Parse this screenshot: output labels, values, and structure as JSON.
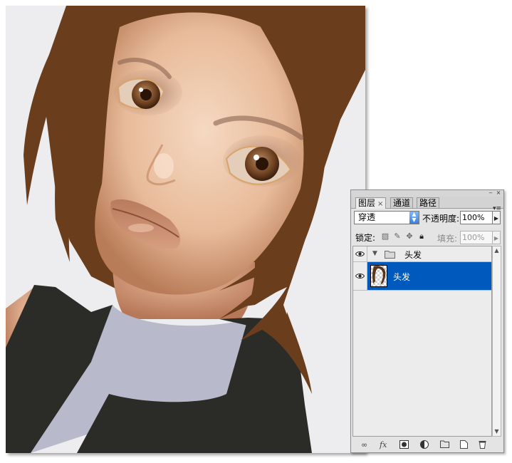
{
  "panel": {
    "tabs": [
      {
        "label": "图层",
        "close": "×"
      },
      {
        "label": "通道"
      },
      {
        "label": "路径"
      }
    ],
    "window_buttons": {
      "minimize": "‒",
      "close": "×"
    },
    "menu_icon": "▾≡",
    "blend_mode": "穿透",
    "opacity_label": "不透明度:",
    "opacity_value": "100%",
    "lock_label": "锁定:",
    "fill_label": "填充:",
    "fill_value": "100%",
    "layers": [
      {
        "name": "头发",
        "kind": "group",
        "expanded": true,
        "visible": true
      },
      {
        "name": "头发",
        "kind": "layer",
        "selected": true,
        "visible": true
      }
    ],
    "bottom_icons": [
      "link-icon",
      "fx-icon",
      "mask-icon",
      "adjustment-icon",
      "new-group-icon",
      "new-layer-icon",
      "trash-icon"
    ],
    "fx_label": "fx",
    "selection_color": "#0059bd"
  },
  "canvas": {
    "hair_color": "#6a3e1c",
    "background_color": "#ededf0",
    "collar_color": "#b9b9cc",
    "dress_color": "#2b2b27"
  }
}
